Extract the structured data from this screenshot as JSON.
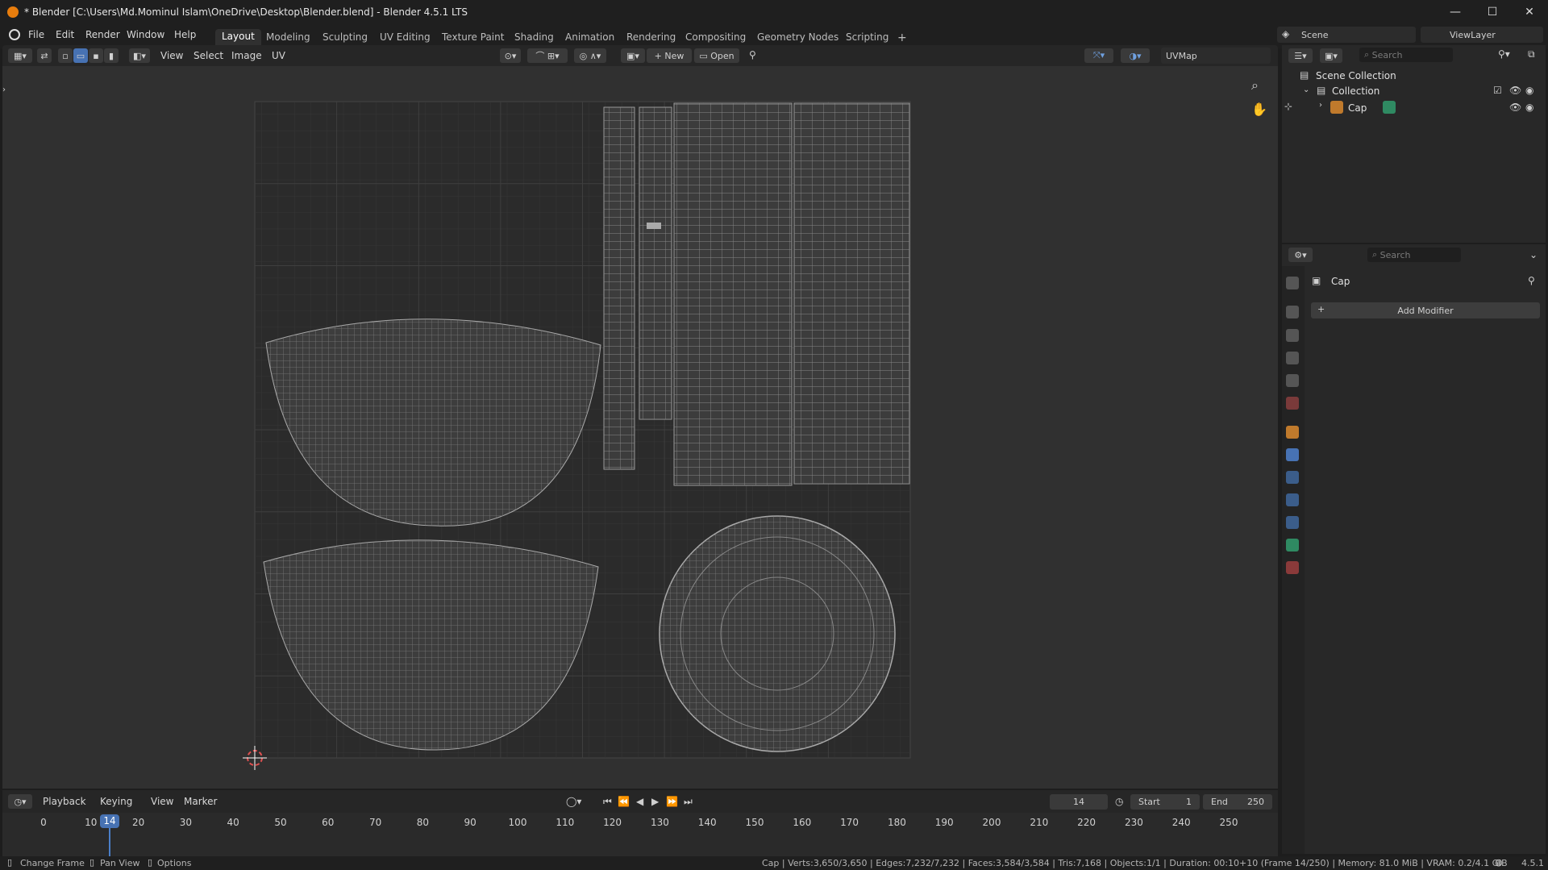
{
  "window": {
    "title": "* Blender [C:\\Users\\Md.Mominul Islam\\OneDrive\\Desktop\\Blender.blend] - Blender 4.5.1 LTS"
  },
  "menu": [
    "File",
    "Edit",
    "Render",
    "Window",
    "Help"
  ],
  "workspaces": [
    "Layout",
    "Modeling",
    "Sculpting",
    "UV Editing",
    "Texture Paint",
    "Shading",
    "Animation",
    "Rendering",
    "Compositing",
    "Geometry Nodes",
    "Scripting"
  ],
  "topright": {
    "scene": "Scene",
    "viewlayer": "ViewLayer"
  },
  "uv_header": {
    "menus": [
      "View",
      "Select",
      "Image",
      "UV"
    ],
    "new_label": "New",
    "open_label": "Open",
    "uvmap": "UVMap"
  },
  "outliner": {
    "search_placeholder": "Search",
    "scene_collection": "Scene Collection",
    "collection": "Collection",
    "object": "Cap"
  },
  "properties": {
    "search_placeholder": "Search",
    "object": "Cap",
    "add_modifier": "Add Modifier"
  },
  "timeline": {
    "menus": [
      "Playback",
      "Keying",
      "View",
      "Marker"
    ],
    "current_frame": "14",
    "start_label": "Start",
    "start": "1",
    "end_label": "End",
    "end": "250",
    "ticks": [
      "0",
      "10",
      "20",
      "30",
      "40",
      "50",
      "60",
      "70",
      "80",
      "90",
      "100",
      "110",
      "120",
      "130",
      "140",
      "150",
      "160",
      "170",
      "180",
      "190",
      "200",
      "210",
      "220",
      "230",
      "240",
      "250"
    ]
  },
  "status": {
    "change_frame": "Change Frame",
    "pan_view": "Pan View",
    "options": "Options",
    "stats": "Cap | Verts:3,650/3,650 | Edges:7,232/7,232 | Faces:3,584/3,584 | Tris:7,168 | Objects:1/1 | Duration: 00:10+10 (Frame 14/250) | Memory: 81.0 MiB | VRAM: 0.2/4.1 GiB",
    "version": "4.5.1"
  },
  "colors": {
    "accent": "#4772b3",
    "frame_line": "#4a7fc8"
  }
}
